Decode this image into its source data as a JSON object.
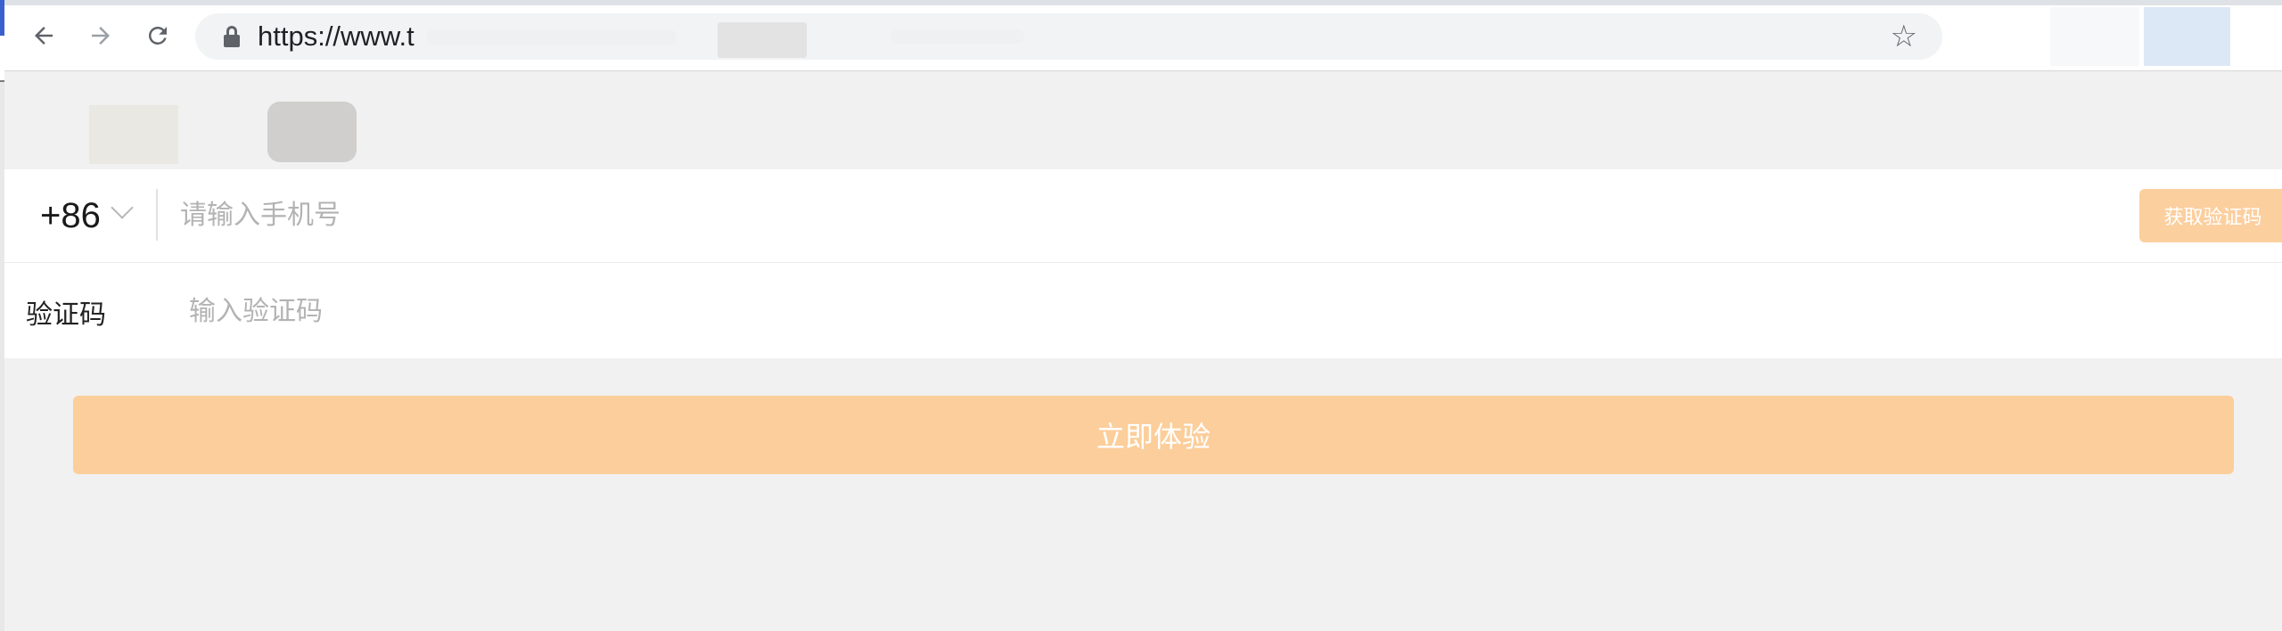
{
  "browser": {
    "url": "https://www.t",
    "back_icon": "arrow-left-icon",
    "forward_icon": "arrow-right-icon",
    "reload_icon": "reload-icon",
    "lock_icon": "lock-icon",
    "bookmark_icon": "star-icon"
  },
  "form": {
    "country_code": "+86",
    "phone_placeholder": "请输入手机号",
    "get_code_label": "获取验证码",
    "code_label": "验证码",
    "code_placeholder": "输入验证码"
  },
  "submit": {
    "label": "立即体验"
  },
  "colors": {
    "accent": "#fcce9b",
    "page_bg": "#f1f1f1",
    "card_bg": "#ffffff"
  }
}
